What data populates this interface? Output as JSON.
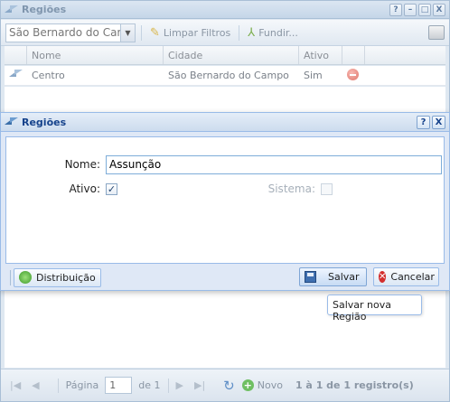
{
  "background_window": {
    "title": "Regiões",
    "tools": {
      "help": "?",
      "minimize": "–",
      "maximize": "□",
      "close": "X"
    },
    "toolbar": {
      "combo_value": "São Bernardo do Campo",
      "clear_filters_label": "Limpar Filtros",
      "merge_label": "Fundir..."
    },
    "grid": {
      "columns": [
        "Nome",
        "Cidade",
        "Ativo"
      ],
      "rows": [
        {
          "nome": "Centro",
          "cidade": "São Bernardo do Campo",
          "ativo": "Sim"
        }
      ]
    },
    "pager": {
      "page_label": "Página",
      "page_value": "1",
      "of_label": "de 1",
      "new_label": "Novo",
      "info": "1 à 1 de 1 registro(s)"
    }
  },
  "modal": {
    "title": "Regiões",
    "tools": {
      "help": "?",
      "close": "X"
    },
    "fields": {
      "nome_label": "Nome:",
      "nome_value": "Assunção",
      "ativo_label": "Ativo:",
      "ativo_checked": true,
      "sistema_label": "Sistema:",
      "sistema_checked": false
    },
    "buttons": {
      "distribution_label": "Distribuição",
      "save_label": "Salvar",
      "cancel_label": "Cancelar"
    }
  },
  "tooltip": {
    "text": "Salvar nova Região"
  }
}
